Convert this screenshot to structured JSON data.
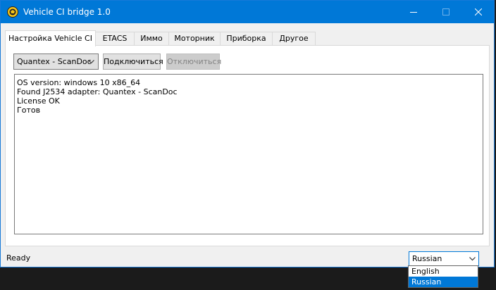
{
  "window": {
    "title": "Vehicle CI bridge  1.0"
  },
  "tabs": [
    {
      "label": "Настройка Vehicle CI",
      "active": true
    },
    {
      "label": "ETACS"
    },
    {
      "label": "Иммо"
    },
    {
      "label": "Моторник"
    },
    {
      "label": "Приборка"
    },
    {
      "label": "Другое"
    }
  ],
  "connection": {
    "adapter_select_value": "Quantex - ScanDoc",
    "connect_label": "Подключиться",
    "disconnect_label": "Отключиться",
    "disconnect_enabled": false
  },
  "log": {
    "lines": [
      "OS version: windows 10 x86_64",
      "Found J2534 adapter: Quantex - ScanDoc",
      "License OK",
      "Готов"
    ]
  },
  "status": {
    "text": "Ready"
  },
  "language": {
    "selected": "Russian",
    "options": [
      "English",
      "Russian"
    ],
    "highlighted_option": "Russian"
  },
  "colors": {
    "accent": "#0078d7",
    "titlebar_text": "#ffffff",
    "disabled_text": "#838383"
  }
}
